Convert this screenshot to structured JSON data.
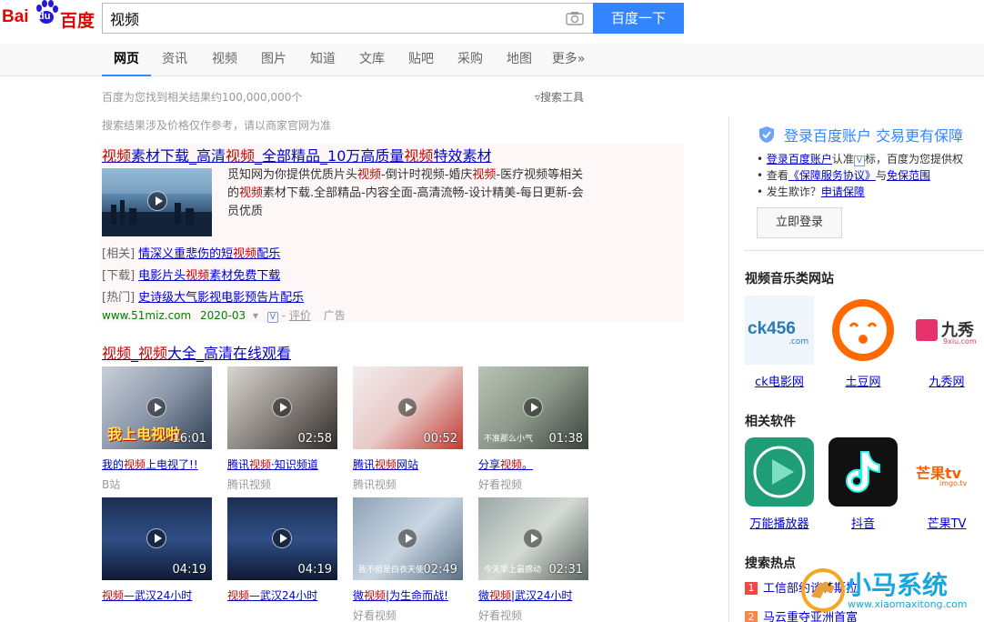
{
  "header": {
    "logo_latin": "Bai",
    "logo_du": "du",
    "logo_cn": "百度",
    "search_value": "视频",
    "search_button": "百度一下"
  },
  "nav": {
    "tabs": [
      "网页",
      "资讯",
      "视频",
      "图片",
      "知道",
      "文库",
      "贴吧",
      "采购",
      "地图",
      "更多»"
    ],
    "active": "网页"
  },
  "stats": "百度为您找到相关结果约100,000,000个",
  "tools": "搜索工具",
  "notice": "搜索结果涉及价格仅作参考，请以商家官网为准",
  "ad_result": {
    "title_parts": [
      "视频",
      "素材下载_高清",
      "视频",
      "_全部精品_10万高质量",
      "视频",
      "特效素材"
    ],
    "desc_parts": [
      "觅知网为你提供优质片头",
      "视频",
      "-倒计时视频-婚庆",
      "视频",
      "-医疗视频等相关的",
      "视频",
      "素材下载.全部精品-内容全面-高清流畅-设计精美-每日更新-会员优质"
    ],
    "sub_links": [
      {
        "tag": "[相关]",
        "parts": [
          "情深义重悲伤的短",
          "视频",
          "配乐"
        ]
      },
      {
        "tag": "[下载]",
        "parts": [
          "电影片头",
          "视频",
          "素材免费下载"
        ]
      },
      {
        "tag": "[热门]",
        "parts": [
          "史诗级大气影视电影预告片配乐",
          "",
          ""
        ]
      }
    ],
    "site": "www.51miz.com",
    "date": "2020-03",
    "review": "评价",
    "ad_tag": "广告"
  },
  "video_result": {
    "title_parts": [
      "视频",
      "_",
      "视频",
      "大全_高清在线观看"
    ],
    "videos": [
      {
        "label_parts": [
          "我的",
          "视频",
          "上电视了!!"
        ],
        "source": "B站",
        "duration": "16:01",
        "caption": "我上电视啦"
      },
      {
        "label_parts": [
          "腾讯",
          "视频",
          "·知识频道"
        ],
        "source": "腾讯视频",
        "duration": "02:58",
        "caption": ""
      },
      {
        "label_parts": [
          "腾讯",
          "视频",
          "网站"
        ],
        "source": "腾讯视频",
        "duration": "00:52",
        "caption": ""
      },
      {
        "label_parts": [
          "分享",
          "视频",
          "。"
        ],
        "source": "好看视频",
        "duration": "01:38",
        "caption": "不准那么小气"
      },
      {
        "label_parts": [
          "视频",
          "—武汉24小时",
          ""
        ],
        "source": "",
        "duration": "04:19",
        "caption": ""
      },
      {
        "label_parts": [
          "视频",
          "—武汉24小时",
          ""
        ],
        "source": "",
        "duration": "04:19",
        "caption": ""
      },
      {
        "label_parts": [
          "微",
          "视频",
          "|为生命而战!"
        ],
        "source": "好看视频",
        "duration": "02:49",
        "caption": "我不但是白衣天使"
      },
      {
        "label_parts": [
          "微",
          "视频",
          "|武汉24小时"
        ],
        "source": "好看视频",
        "duration": "02:31",
        "caption": "今天早上最感动"
      }
    ]
  },
  "right": {
    "login_title": "登录百度账户 交易更有保障",
    "login_rows": [
      {
        "parts": [
          "登录百度账户",
          "认准",
          "标，百度为您提供权"
        ]
      },
      {
        "parts": [
          "查看",
          "《保障服务协议》",
          "与",
          "免保范围"
        ]
      },
      {
        "parts": [
          "发生欺诈？",
          "申请保障"
        ]
      }
    ],
    "login_button": "立即登录",
    "music_section": "视频音乐类网站",
    "music_sites": [
      {
        "name": "ck电影网",
        "logo": "ck456",
        "logo_sub": ".com"
      },
      {
        "name": "土豆网",
        "logo": "",
        "logo_sub": ""
      },
      {
        "name": "九秀网",
        "logo": "九秀",
        "logo_sub": "9xiu.com"
      }
    ],
    "software_section": "相关软件",
    "software": [
      {
        "name": "万能播放器",
        "logo": ""
      },
      {
        "name": "抖音",
        "logo": ""
      },
      {
        "name": "芒果TV",
        "logo": "芒果tv",
        "logo_sub": "imgo.tv"
      }
    ],
    "hot_section": "搜索热点",
    "hot_items": [
      {
        "num": "1",
        "text": "工信部约谈特斯拉"
      },
      {
        "num": "2",
        "text": "马云重夺亚洲首富"
      }
    ]
  },
  "watermark": {
    "text": "小马系统",
    "url": "www.xiaomaxitong.com"
  },
  "colors": {
    "brand_red": "#e10602",
    "link_blue": "#0000cc",
    "highlight_red": "#cc0000",
    "button_blue": "#3385ff",
    "site_green": "#008000"
  }
}
